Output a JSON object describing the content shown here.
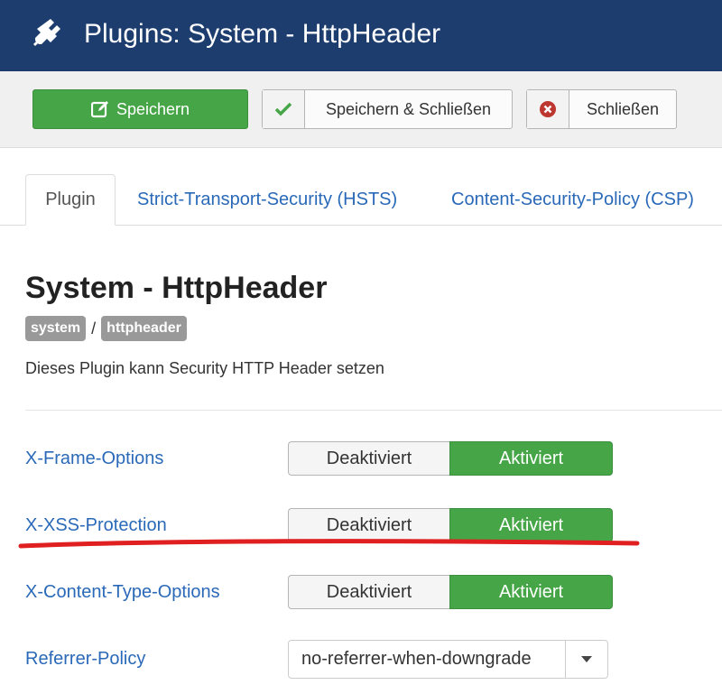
{
  "header": {
    "title": "Plugins: System - HttpHeader",
    "icon": "plug-icon"
  },
  "toolbar": {
    "save_label": "Speichern",
    "save_close_label": "Speichern & Schließen",
    "close_label": "Schließen"
  },
  "tabs": [
    {
      "label": "Plugin",
      "active": true
    },
    {
      "label": "Strict-Transport-Security (HSTS)",
      "active": false
    },
    {
      "label": "Content-Security-Policy (CSP)",
      "active": false
    }
  ],
  "plugin": {
    "title": "System - HttpHeader",
    "badges": [
      "system",
      "httpheader"
    ],
    "separator": "/",
    "description": "Dieses Plugin kann Security HTTP Header setzen"
  },
  "options": [
    {
      "label": "X-Frame-Options",
      "off_label": "Deaktiviert",
      "on_label": "Aktiviert",
      "value": "Aktiviert"
    },
    {
      "label": "X-XSS-Protection",
      "off_label": "Deaktiviert",
      "on_label": "Aktiviert",
      "value": "Aktiviert"
    },
    {
      "label": "X-Content-Type-Options",
      "off_label": "Deaktiviert",
      "on_label": "Aktiviert",
      "value": "Aktiviert"
    }
  ],
  "referrer": {
    "label": "Referrer-Policy",
    "value": "no-referrer-when-downgrade"
  },
  "colors": {
    "header_bg": "#1c3d6e",
    "success": "#46a546",
    "link": "#2a69b8",
    "annotation": "#e02020"
  }
}
